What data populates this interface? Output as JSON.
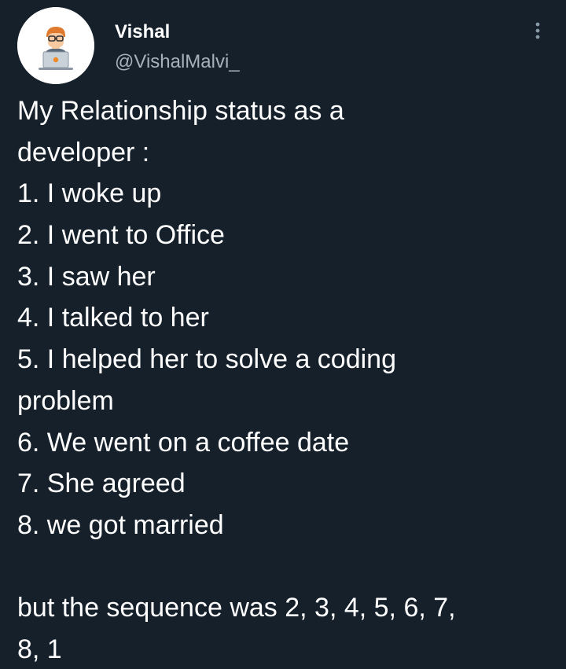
{
  "author": {
    "display_name": "Vishal",
    "handle": "@VishalMalvi_",
    "avatar_icon": "developer-laptop-avatar-icon"
  },
  "menu": {
    "icon": "more-vertical-icon"
  },
  "tweet": {
    "lines": [
      "My Relationship status as a",
      "developer :",
      "1. I woke up",
      "2. I went to Office",
      "3. I saw her",
      "4. I talked to her",
      "5. I helped her to solve a coding",
      "problem",
      "6. We went on a coffee date",
      "7. She agreed",
      "8. we got married"
    ],
    "footer_lines": [
      "but the sequence was 2, 3, 4, 5, 6, 7,",
      "8, 1"
    ]
  },
  "colors": {
    "background": "#15202b",
    "text": "#ffffff",
    "secondary_text": "#a6b1bc"
  }
}
